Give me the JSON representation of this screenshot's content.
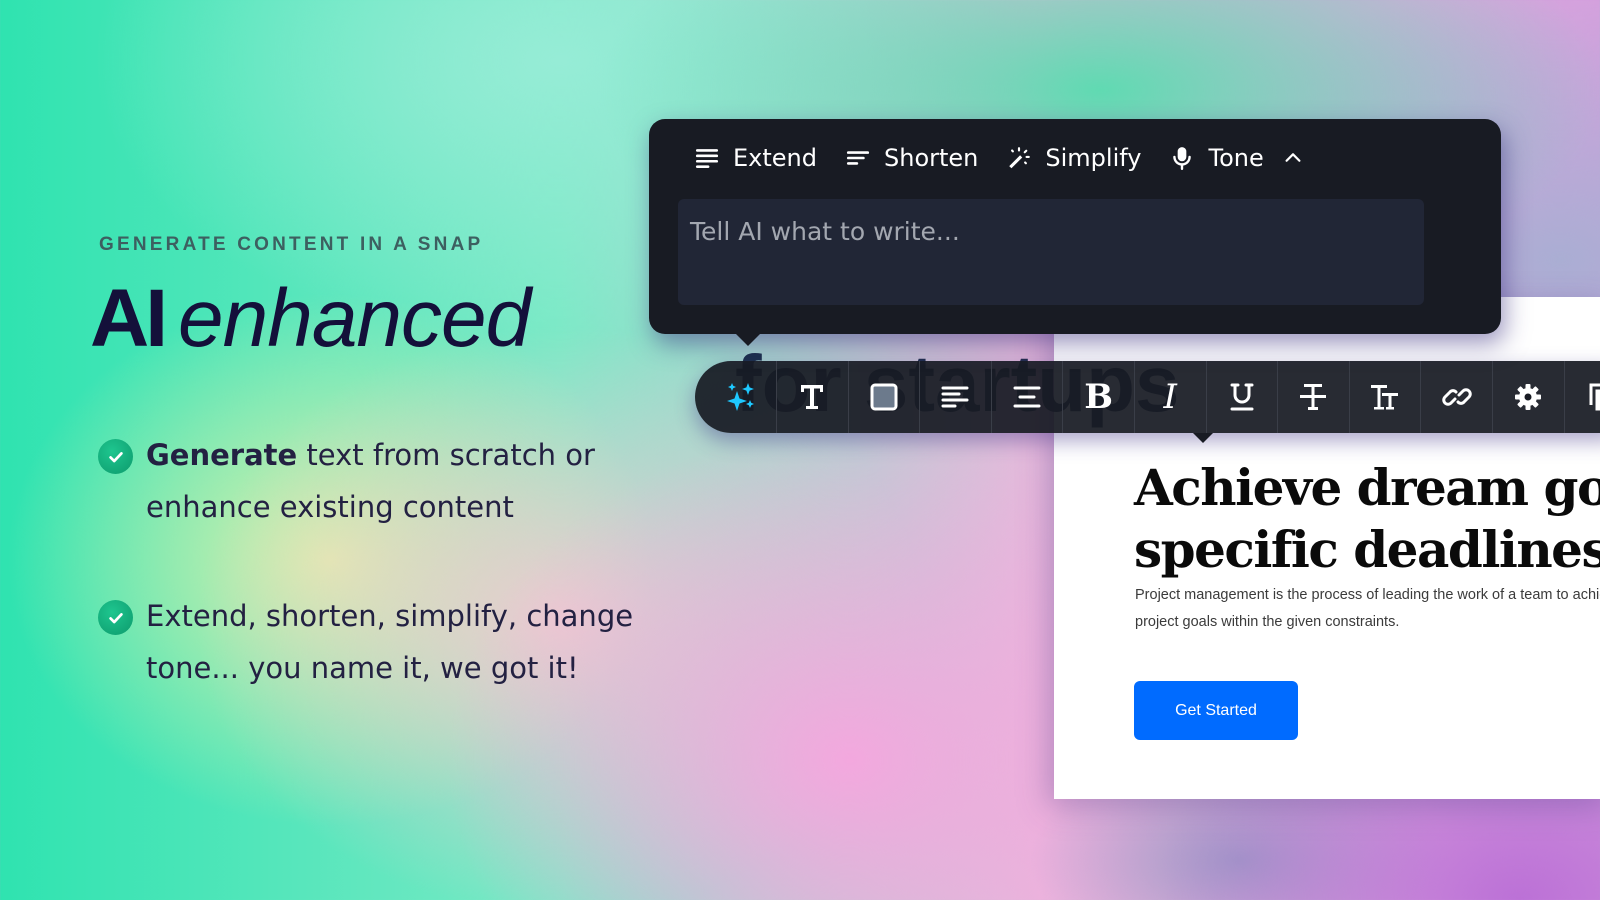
{
  "marketing": {
    "eyebrow": "GENERATE CONTENT IN A SNAP",
    "headline_strong": "AI",
    "headline_light": "enhanced",
    "features": [
      {
        "bold": "Generate",
        "text": " text from scratch or enhance existing content",
        "icon": "check-circle-icon"
      },
      {
        "bold": "",
        "text": "Extend, shorten, simplify, change tone... you name it, we got it!",
        "icon": "check-circle-icon"
      }
    ]
  },
  "ai_popup": {
    "actions": [
      {
        "label": "Extend",
        "icon": "align-justify-icon"
      },
      {
        "label": "Shorten",
        "icon": "align-short-icon"
      },
      {
        "label": "Simplify",
        "icon": "magic-wand-icon"
      },
      {
        "label": "Tone",
        "icon": "microphone-icon",
        "has_dropdown": true
      }
    ],
    "prompt_placeholder": "Tell AI what to write...",
    "prompt_value": ""
  },
  "format_toolbar": {
    "buttons": [
      {
        "name": "ai-sparkles",
        "icon": "sparkles-icon",
        "active": true
      },
      {
        "name": "text-style",
        "icon": "text-t-icon"
      },
      {
        "name": "background-color",
        "icon": "color-square-icon"
      },
      {
        "name": "align-left",
        "icon": "align-left-icon"
      },
      {
        "name": "align-center",
        "icon": "align-center-icon"
      },
      {
        "name": "bold",
        "icon": "bold-icon"
      },
      {
        "name": "italic",
        "icon": "italic-icon"
      },
      {
        "name": "underline",
        "icon": "underline-icon"
      },
      {
        "name": "strikethrough",
        "icon": "strikethrough-icon"
      },
      {
        "name": "font-size",
        "icon": "font-size-icon"
      },
      {
        "name": "link",
        "icon": "link-icon"
      },
      {
        "name": "settings",
        "icon": "gear-icon"
      },
      {
        "name": "duplicate",
        "icon": "copy-icon"
      }
    ],
    "accent_color": "#1ec8ff"
  },
  "page": {
    "ghost_title": "for startups",
    "heading_line1": "Achieve dream goals",
    "heading_line2": "specific deadlines.",
    "body": "Project management is the process of leading the work of a team to achieve all project goals within the given constraints.",
    "cta_label": "Get Started",
    "cta_color": "#006bff"
  }
}
